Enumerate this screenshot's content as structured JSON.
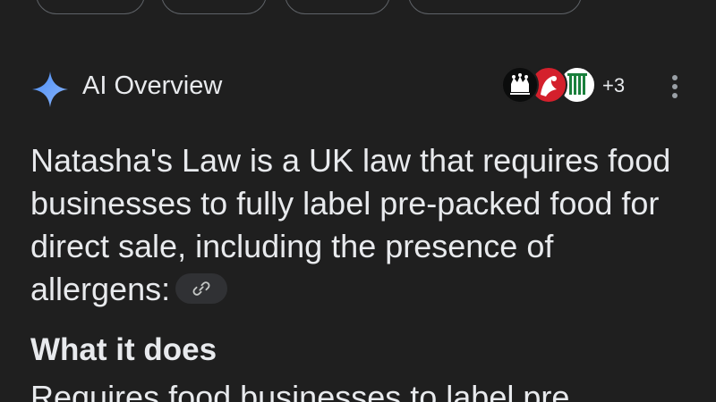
{
  "ai_overview": {
    "title": "AI Overview",
    "sources_more": "+3",
    "summary": "Natasha's Law is a UK law that requires food businesses to fully label pre-packed food for direct sale, including the presence of allergens:",
    "section_heading": "What it does",
    "next_line": "Requires food businesses to label pre"
  },
  "icons": {
    "spark": "sparkle-icon",
    "more": "more-vert-icon",
    "link": "link-icon"
  },
  "colors": {
    "background": "#1f1f1f",
    "text": "#e8eaed",
    "accent_spark": "#4b8ef7",
    "chip_border": "#5f6368",
    "link_chip_bg": "#303134"
  }
}
